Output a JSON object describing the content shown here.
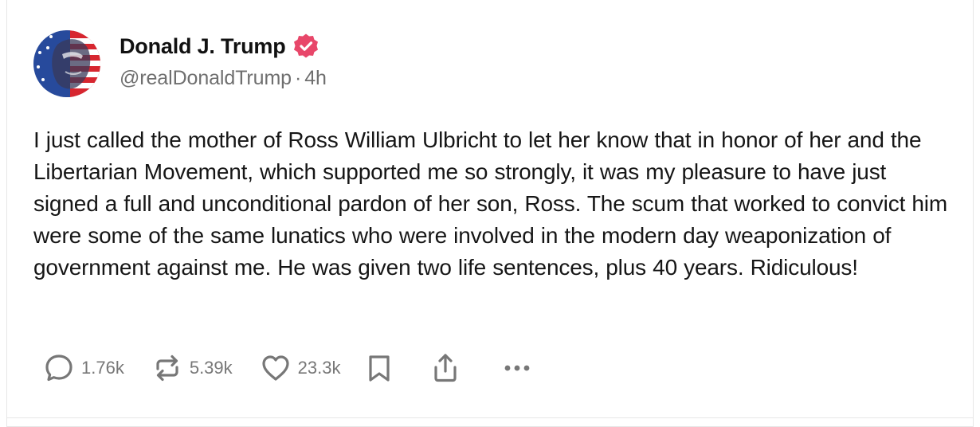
{
  "post": {
    "author": {
      "display_name": "Donald J. Trump",
      "handle": "@realDonaldTrump",
      "separator": "·",
      "timestamp": "4h",
      "verified": true
    },
    "text": "I just called the mother of Ross William Ulbricht to let her know that in honor of her and the Libertarian Movement, which supported me so strongly, it was my pleasure to have just signed a full and unconditional pardon of her son, Ross. The scum that worked to convict him were some of the same lunatics who were involved in the modern day weaponization of government against me. He was given two life sentences, plus 40 years. Ridiculous!",
    "stats": {
      "replies": "1.76k",
      "reposts": "5.39k",
      "likes": "23.3k"
    }
  },
  "icons": {
    "reply": "speech-bubble-icon",
    "repost": "repost-arrows-icon",
    "like": "heart-icon",
    "bookmark": "bookmark-icon",
    "share": "share-upload-icon",
    "more": "ellipsis-icon",
    "verified": "verified-badge-icon"
  },
  "colors": {
    "verified_badge": "#e8476a",
    "muted_text": "#6f6f6f",
    "icon_gray": "#777777",
    "body_text": "#161616"
  }
}
